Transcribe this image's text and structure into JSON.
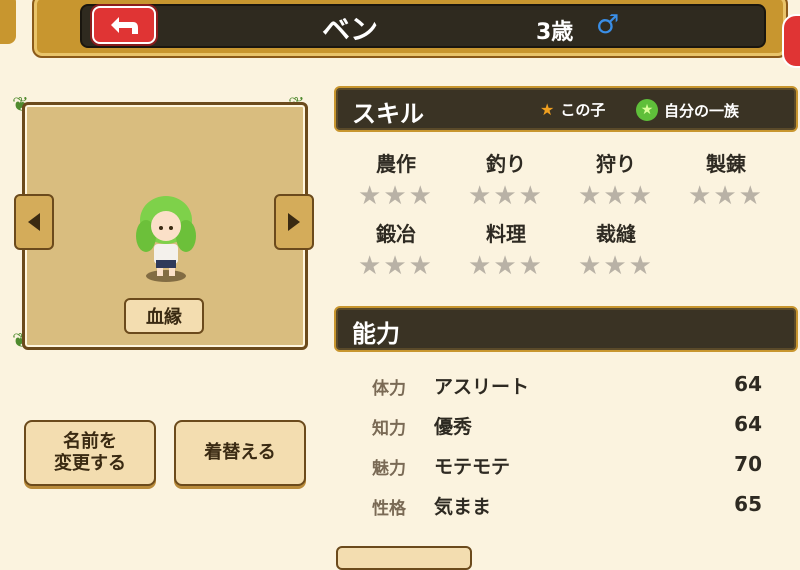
{
  "header": {
    "name": "ベン",
    "age": "3歳",
    "gender_symbol": "♂",
    "back_icon": "back-arrow-icon"
  },
  "portrait": {
    "bloodline_label": "血縁",
    "prev_icon": "arrow-left-icon",
    "next_icon": "arrow-right-icon"
  },
  "buttons": {
    "rename": [
      "名前を",
      "変更する"
    ],
    "change_clothes": "着替える"
  },
  "skills": {
    "title": "スキル",
    "legend_self": "この子",
    "legend_family": "自分の一族",
    "items": [
      {
        "name": "農作",
        "stars": 0
      },
      {
        "name": "釣り",
        "stars": 0
      },
      {
        "name": "狩り",
        "stars": 0
      },
      {
        "name": "製錬",
        "stars": 0
      },
      {
        "name": "鍛冶",
        "stars": 0
      },
      {
        "name": "料理",
        "stars": 0
      },
      {
        "name": "裁縫",
        "stars": 0
      }
    ]
  },
  "abilities": {
    "title": "能力",
    "rows": [
      {
        "label": "体力",
        "value": "アスリート",
        "number": "64"
      },
      {
        "label": "知力",
        "value": "優秀",
        "number": "64"
      },
      {
        "label": "魅力",
        "value": "モテモテ",
        "number": "70"
      },
      {
        "label": "性格",
        "value": "気まま",
        "number": "65"
      }
    ]
  },
  "colors": {
    "background": "#fbf3df",
    "header_dark": "#2f2a1f",
    "gold": "#c8962f",
    "red_button": "#e03434",
    "male_blue": "#3a8ee6"
  }
}
